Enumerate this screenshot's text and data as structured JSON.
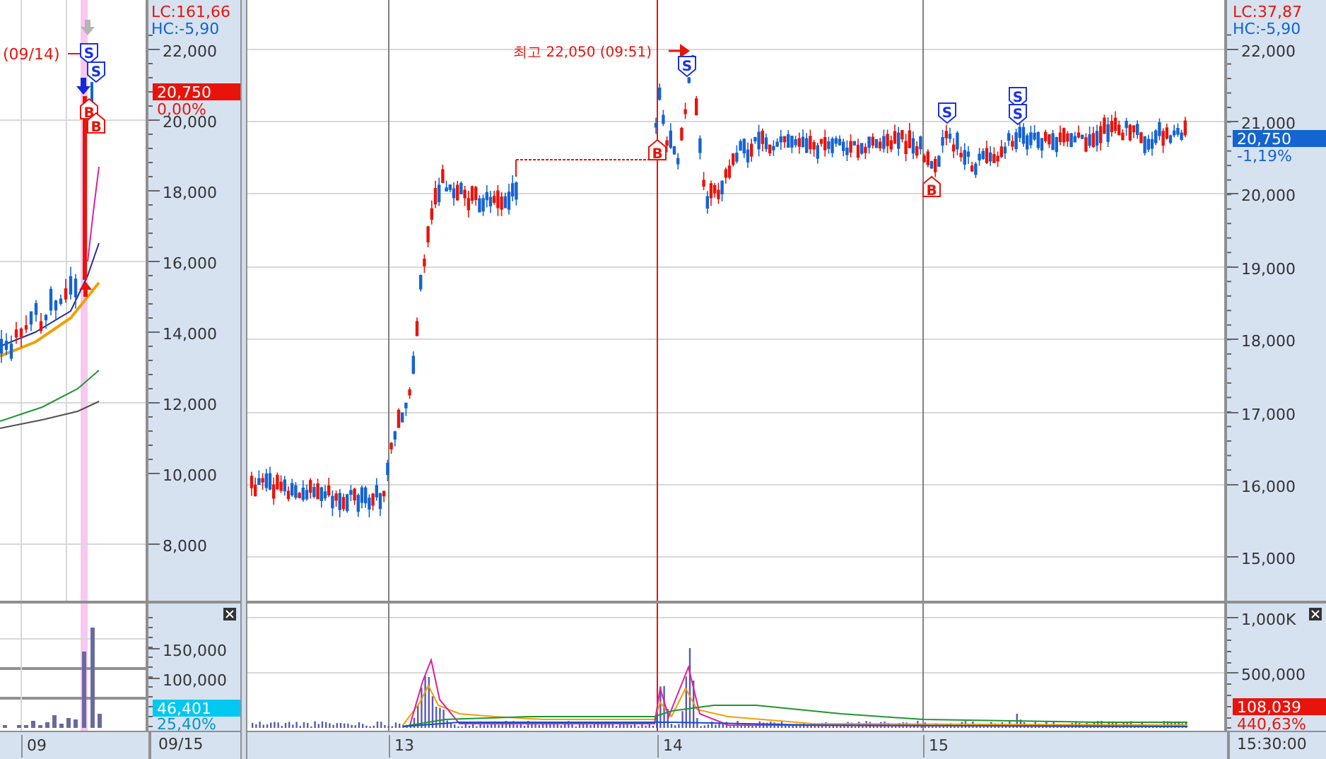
{
  "left_panel": {
    "price_axis": {
      "lc": "LC:161,66",
      "hc": "HC:-5,90",
      "labels": [
        "22,000",
        "20,000",
        "18,000",
        "16,000",
        "14,000",
        "12,000",
        "10,000",
        "8,000"
      ],
      "current_price": "20,750",
      "change": "0,00%",
      "color": "#e8140c"
    },
    "date_marker": "(09/14)",
    "signals": [
      {
        "kind": "sell",
        "label": "S"
      },
      {
        "kind": "sell",
        "label": "S"
      },
      {
        "kind": "buy",
        "label": "B"
      },
      {
        "kind": "buy",
        "label": "B"
      }
    ],
    "volume_axis": {
      "labels": [
        "150,000",
        "100,000"
      ],
      "current_volume": "46,401",
      "volume_ratio": "25,40%",
      "color": "#00c8f0"
    },
    "date_labels": [
      "09"
    ],
    "axis_date": "09/15"
  },
  "right_panel": {
    "price_axis": {
      "lc": "LC:37,87",
      "hc": "HC:-5,90",
      "labels": [
        "22,000",
        "21,000",
        "20,000",
        "19,000",
        "18,000",
        "17,000",
        "16,000",
        "15,000"
      ],
      "current_price": "20,750",
      "change": "-1,19%",
      "color": "#1464d2"
    },
    "high_annotation": "최고 22,050 (09:51)",
    "signals": [
      {
        "kind": "buy",
        "label": "B"
      },
      {
        "kind": "sell",
        "label": "S"
      },
      {
        "kind": "buy",
        "label": "B"
      },
      {
        "kind": "sell",
        "label": "S"
      },
      {
        "kind": "sell",
        "label": "S"
      },
      {
        "kind": "sell",
        "label": "S"
      }
    ],
    "volume_axis": {
      "labels": [
        "1,000K",
        "500,000"
      ],
      "current_volume": "108,039",
      "volume_ratio": "440,63%",
      "color": "#e8140c"
    },
    "date_labels": [
      "13",
      "14",
      "15"
    ],
    "axis_time": "15:30:00"
  }
}
